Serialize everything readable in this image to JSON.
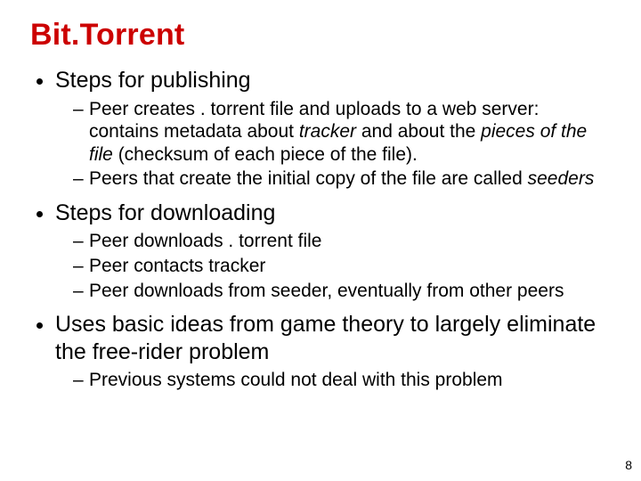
{
  "title": "Bit.Torrent",
  "bullets": {
    "b1": "Steps for publishing",
    "b1_sub1_a": "Peer creates . torrent file and uploads to a web server: contains metadata about ",
    "b1_sub1_i1": "tracker",
    "b1_sub1_b": " and about the ",
    "b1_sub1_i2": "pieces of the file",
    "b1_sub1_c": " (checksum of each piece of the file).",
    "b1_sub2_a": "Peers that create the initial copy of the file are called ",
    "b1_sub2_i1": "seeders",
    "b2": "Steps for downloading",
    "b2_sub1": "Peer downloads . torrent file",
    "b2_sub2": "Peer contacts tracker",
    "b2_sub3": "Peer downloads from seeder, eventually from other peers",
    "b3": "Uses basic ideas from game theory to largely eliminate the free-rider problem",
    "b3_sub1": "Previous systems could not deal with this problem"
  },
  "page_number": "8"
}
